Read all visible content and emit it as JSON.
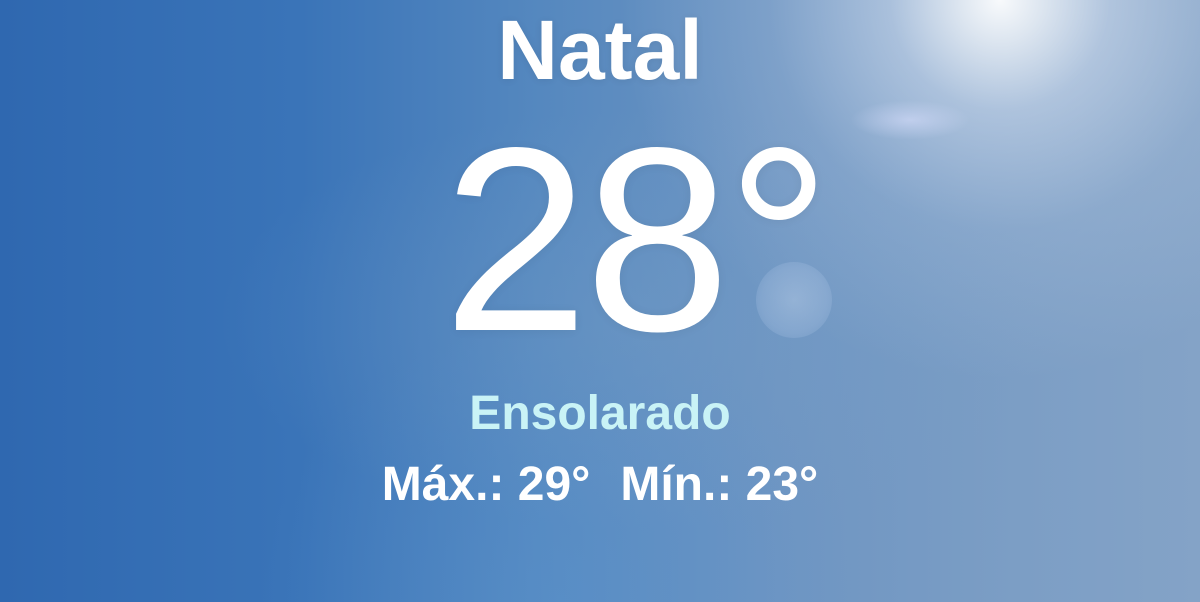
{
  "weather": {
    "city": "Natal",
    "temperature": "28°",
    "condition": "Ensolarado",
    "high_label": "Máx.: 29°",
    "low_label": "Mín.: 23°"
  },
  "colors": {
    "condition_text": "#c9f3f6",
    "primary_text": "#ffffff",
    "sky_left": "#2f68b0",
    "sky_right": "#84a3c7"
  },
  "icons": [
    "sun-flare"
  ]
}
